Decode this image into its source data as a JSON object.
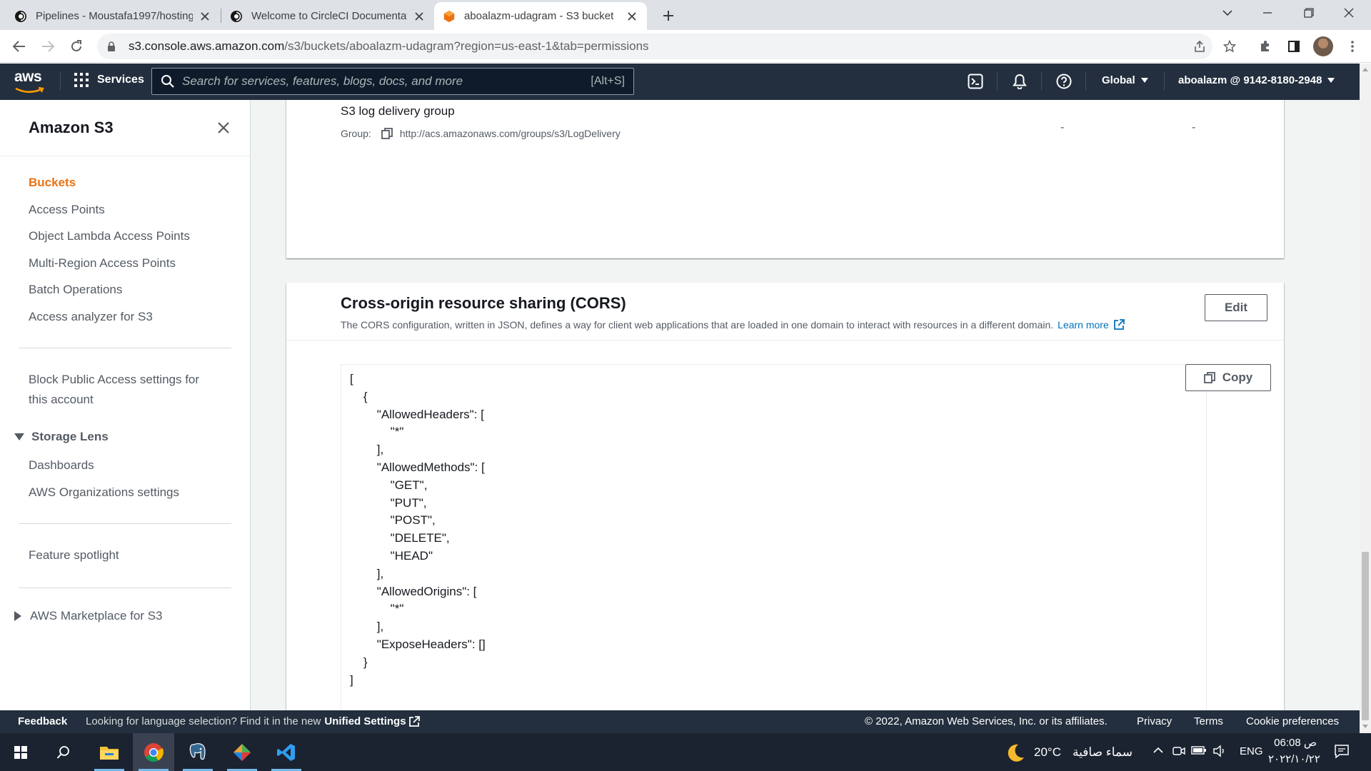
{
  "browser": {
    "tabs": [
      {
        "title": "Pipelines - Moustafa1997/hosting",
        "active": false
      },
      {
        "title": "Welcome to CircleCI Documentation",
        "active": false
      },
      {
        "title": "aboalazm-udagram - S3 bucket",
        "active": true
      }
    ],
    "url_host": "s3.console.aws.amazon.com",
    "url_rest": "/s3/buckets/aboalazm-udagram?region=us-east-1&tab=permissions"
  },
  "aws_nav": {
    "logo": "aws",
    "services_label": "Services",
    "search_placeholder": "Search for services, features, blogs, docs, and more",
    "search_shortcut": "[Alt+S]",
    "region": "Global",
    "account": "aboalazm @ 9142-8180-2948"
  },
  "sidebar": {
    "title": "Amazon S3",
    "items": [
      {
        "label": "Buckets",
        "active": true
      },
      {
        "label": "Access Points"
      },
      {
        "label": "Object Lambda Access Points"
      },
      {
        "label": "Multi-Region Access Points"
      },
      {
        "label": "Batch Operations"
      },
      {
        "label": "Access analyzer for S3"
      }
    ],
    "block_public_line1": "Block Public Access settings for",
    "block_public_line2": "this account",
    "storage_lens": "Storage Lens",
    "storage_lens_items": [
      "Dashboards",
      "AWS Organizations settings"
    ],
    "feature_spotlight": "Feature spotlight",
    "marketplace": "AWS Marketplace for S3"
  },
  "acl_row": {
    "grantee": "S3 log delivery group",
    "group_label": "Group:",
    "group_uri": "http://acs.amazonaws.com/groups/s3/LogDelivery",
    "col1": "-",
    "col2": "-"
  },
  "cors": {
    "title": "Cross-origin resource sharing (CORS)",
    "description": "The CORS configuration, written in JSON, defines a way for client web applications that are loaded in one domain to interact with resources in a different domain.",
    "learn_more": "Learn more",
    "edit_label": "Edit",
    "copy_label": "Copy",
    "json": "[\n    {\n        \"AllowedHeaders\": [\n            \"*\"\n        ],\n        \"AllowedMethods\": [\n            \"GET\",\n            \"PUT\",\n            \"POST\",\n            \"DELETE\",\n            \"HEAD\"\n        ],\n        \"AllowedOrigins\": [\n            \"*\"\n        ],\n        \"ExposeHeaders\": []\n    }\n]"
  },
  "footer": {
    "feedback": "Feedback",
    "lang_text": "Looking for language selection? Find it in the new",
    "unified_settings": "Unified Settings",
    "copyright": "© 2022, Amazon Web Services, Inc. or its affiliates.",
    "privacy": "Privacy",
    "terms": "Terms",
    "cookies": "Cookie preferences"
  },
  "taskbar": {
    "temperature": "20°C",
    "weather": "سماء صافية",
    "language": "ENG",
    "time": "06:08 ص",
    "date": "٢٠٢٢/١٠/٢٢"
  },
  "colors": {
    "aws_nav_bg": "#232f3e",
    "active_orange": "#ec7211",
    "link_blue": "#0073bb"
  }
}
